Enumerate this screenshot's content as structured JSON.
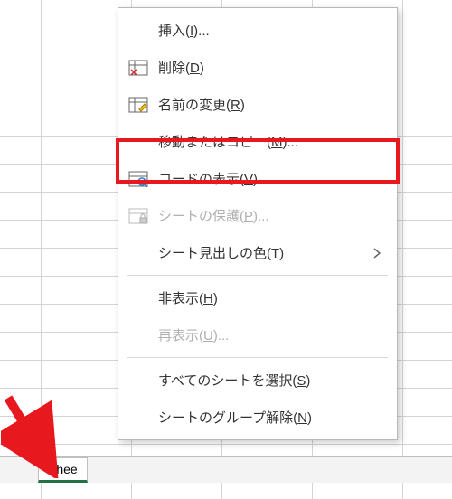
{
  "sheet": {
    "tab_label": "Shee"
  },
  "menu": {
    "insert": "挿入(I)...",
    "delete": "削除(D)",
    "rename": "名前の変更(R)",
    "move_copy": "移動またはコピー(M)...",
    "view_code": "コードの表示(V)",
    "protect": "シートの保護(P)...",
    "tab_color": "シート見出しの色(T)",
    "hide": "非表示(H)",
    "unhide": "再表示(U)...",
    "select_all": "すべてのシートを選択(S)",
    "ungroup": "シートのグループ解除(N)"
  }
}
